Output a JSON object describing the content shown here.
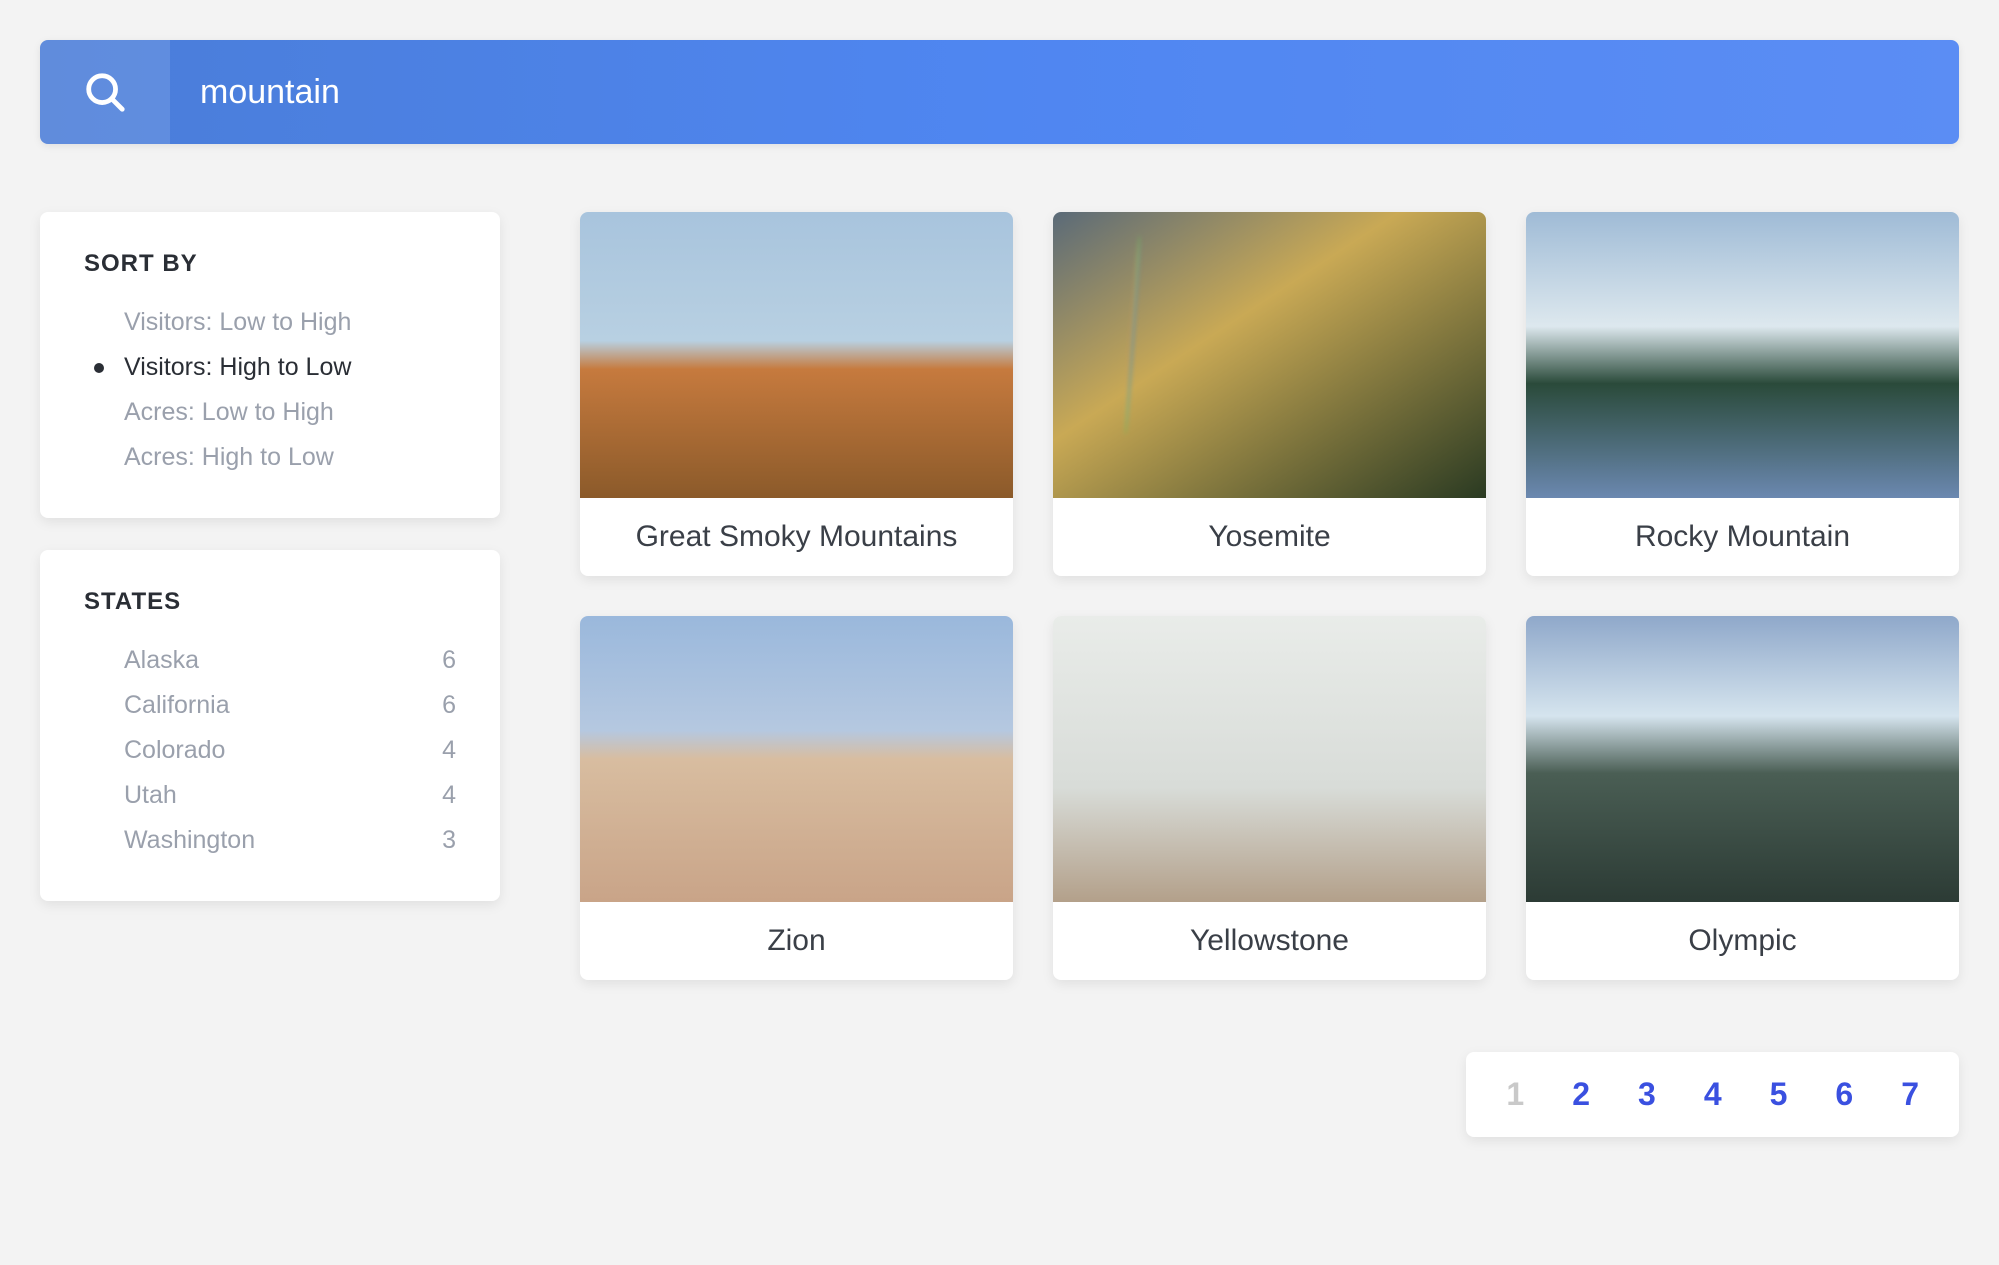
{
  "search": {
    "value": "mountain",
    "placeholder": "Search"
  },
  "sidebar": {
    "sort": {
      "title": "SORT BY",
      "options": [
        {
          "label": "Visitors: Low to High",
          "selected": false
        },
        {
          "label": "Visitors: High to Low",
          "selected": true
        },
        {
          "label": "Acres: Low to High",
          "selected": false
        },
        {
          "label": "Acres: High to Low",
          "selected": false
        }
      ]
    },
    "states": {
      "title": "STATES",
      "items": [
        {
          "name": "Alaska",
          "count": 6
        },
        {
          "name": "California",
          "count": 6
        },
        {
          "name": "Colorado",
          "count": 4
        },
        {
          "name": "Utah",
          "count": 4
        },
        {
          "name": "Washington",
          "count": 3
        }
      ]
    }
  },
  "results": [
    {
      "title": "Great Smoky Mountains",
      "imgClass": "img-smoky"
    },
    {
      "title": "Yosemite",
      "imgClass": "img-yosemite"
    },
    {
      "title": "Rocky Mountain",
      "imgClass": "img-rocky"
    },
    {
      "title": "Zion",
      "imgClass": "img-zion"
    },
    {
      "title": "Yellowstone",
      "imgClass": "img-yellowstone"
    },
    {
      "title": "Olympic",
      "imgClass": "img-olympic"
    }
  ],
  "pagination": {
    "pages": [
      {
        "label": "1",
        "current": true
      },
      {
        "label": "2",
        "current": false
      },
      {
        "label": "3",
        "current": false
      },
      {
        "label": "4",
        "current": false
      },
      {
        "label": "5",
        "current": false
      },
      {
        "label": "6",
        "current": false
      },
      {
        "label": "7",
        "current": false
      }
    ]
  }
}
